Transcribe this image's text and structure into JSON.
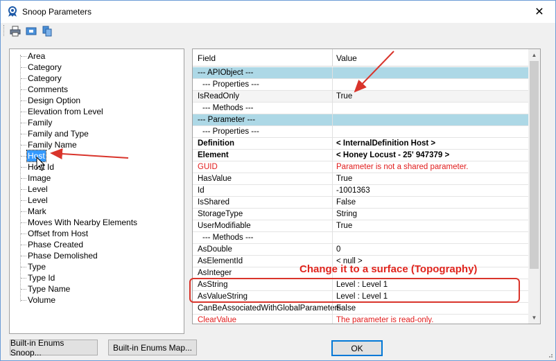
{
  "window": {
    "title": "Snoop Parameters",
    "close_glyph": "✕"
  },
  "toolbar": {
    "icons": [
      "printer-icon",
      "preview-icon",
      "copy-icon"
    ]
  },
  "tree": {
    "items": [
      {
        "label": "Area"
      },
      {
        "label": "Category"
      },
      {
        "label": "Category"
      },
      {
        "label": "Comments"
      },
      {
        "label": "Design Option"
      },
      {
        "label": "Elevation from Level"
      },
      {
        "label": "Family"
      },
      {
        "label": "Family and Type"
      },
      {
        "label": "Family Name"
      },
      {
        "label": "Host",
        "selected": true
      },
      {
        "label": "Host Id"
      },
      {
        "label": "Image"
      },
      {
        "label": "Level"
      },
      {
        "label": "Level"
      },
      {
        "label": "Mark"
      },
      {
        "label": "Moves With Nearby Elements"
      },
      {
        "label": "Offset from Host"
      },
      {
        "label": "Phase Created"
      },
      {
        "label": "Phase Demolished"
      },
      {
        "label": "Type"
      },
      {
        "label": "Type Id"
      },
      {
        "label": "Type Name"
      },
      {
        "label": "Volume"
      }
    ]
  },
  "grid": {
    "headers": {
      "field": "Field",
      "value": "Value"
    },
    "rows": [
      {
        "field": "--- APIObject ---",
        "value": "",
        "style": "hdr"
      },
      {
        "field": "--- Properties ---",
        "value": "",
        "style": "sub"
      },
      {
        "field": "IsReadOnly",
        "value": "True",
        "style": "alt"
      },
      {
        "field": "--- Methods ---",
        "value": "",
        "style": "sub"
      },
      {
        "field": "--- Parameter ---",
        "value": "",
        "style": "hdr"
      },
      {
        "field": "--- Properties ---",
        "value": "",
        "style": "sub"
      },
      {
        "field": "Definition",
        "value": "< InternalDefinition  Host >",
        "style": "bold"
      },
      {
        "field": "Element",
        "value": "< Honey Locust - 25'  947379 >",
        "style": "bold"
      },
      {
        "field": "GUID",
        "value": "Parameter is not a shared parameter.",
        "style": "red"
      },
      {
        "field": "HasValue",
        "value": "True",
        "style": ""
      },
      {
        "field": "Id",
        "value": "-1001363",
        "style": ""
      },
      {
        "field": "IsShared",
        "value": "False",
        "style": ""
      },
      {
        "field": "StorageType",
        "value": "String",
        "style": ""
      },
      {
        "field": "UserModifiable",
        "value": "True",
        "style": ""
      },
      {
        "field": "--- Methods ---",
        "value": "",
        "style": "sub"
      },
      {
        "field": "AsDouble",
        "value": "0",
        "style": ""
      },
      {
        "field": "AsElementId",
        "value": "< null >",
        "style": ""
      },
      {
        "field": "AsInteger",
        "value": "",
        "style": ""
      },
      {
        "field": "AsString",
        "value": "Level : Level 1",
        "style": ""
      },
      {
        "field": "AsValueString",
        "value": "Level : Level 1",
        "style": ""
      },
      {
        "field": "CanBeAssociatedWithGlobalParameters",
        "value": "False",
        "style": ""
      },
      {
        "field": "ClearValue",
        "value": "The parameter is read-only.",
        "style": "red"
      }
    ]
  },
  "buttons": {
    "enums_snoop": "Built-in Enums Snoop...",
    "enums_map": "Built-in Enums Map...",
    "ok": "OK"
  },
  "annotation": {
    "text": "Change it to a surface (Topography)",
    "color": "#e0241d"
  }
}
